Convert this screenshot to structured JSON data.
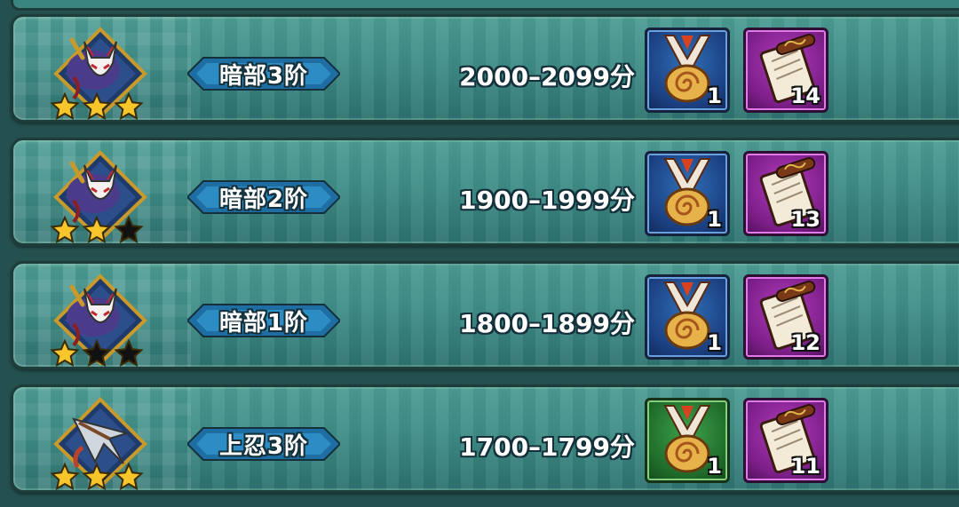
{
  "tiers": [
    {
      "rank": "暗部3阶",
      "range": "2000–2099分",
      "emblem": "fox-mask-icon",
      "stars_filled": 3,
      "stars_total": 3,
      "rewards": [
        {
          "icon": "medal-icon",
          "color": "blue",
          "qty": "1"
        },
        {
          "icon": "scroll-icon",
          "color": "purple",
          "qty": "14"
        }
      ]
    },
    {
      "rank": "暗部2阶",
      "range": "1900–1999分",
      "emblem": "fox-mask-icon",
      "stars_filled": 2,
      "stars_total": 3,
      "rewards": [
        {
          "icon": "medal-icon",
          "color": "blue",
          "qty": "1"
        },
        {
          "icon": "scroll-icon",
          "color": "purple",
          "qty": "13"
        }
      ]
    },
    {
      "rank": "暗部1阶",
      "range": "1800–1899分",
      "emblem": "fox-mask-icon",
      "stars_filled": 1,
      "stars_total": 3,
      "rewards": [
        {
          "icon": "medal-icon",
          "color": "blue",
          "qty": "1"
        },
        {
          "icon": "scroll-icon",
          "color": "purple",
          "qty": "12"
        }
      ]
    },
    {
      "rank": "上忍3阶",
      "range": "1700–1799分",
      "emblem": "kunai-icon",
      "stars_filled": 3,
      "stars_total": 3,
      "rewards": [
        {
          "icon": "medal-icon",
          "color": "green",
          "qty": "1"
        },
        {
          "icon": "scroll-icon",
          "color": "purple",
          "qty": "11"
        }
      ]
    }
  ],
  "colors": {
    "panel": "#3f8d87",
    "border": "#1e3c3a",
    "star_gold": "#f6c62a",
    "star_empty": "#111111"
  }
}
